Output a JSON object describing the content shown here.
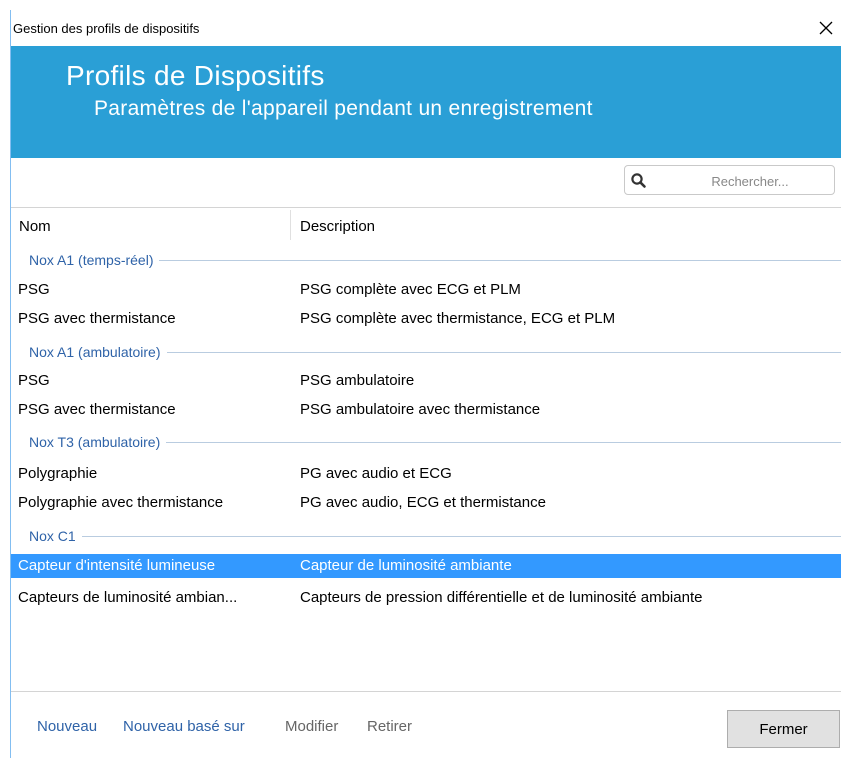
{
  "window": {
    "title": "Gestion des profils de dispositifs"
  },
  "banner": {
    "title": "Profils de Dispositifs",
    "subtitle": "Paramètres de l'appareil pendant un enregistrement",
    "color": "#2a9fd6"
  },
  "search": {
    "placeholder": "Rechercher..."
  },
  "table": {
    "columns": [
      "Nom",
      "Description"
    ],
    "groups": [
      {
        "label": "Nox A1 (temps-réel)",
        "rows": [
          {
            "name": "PSG",
            "description": "PSG complète avec ECG et PLM"
          },
          {
            "name": "PSG avec thermistance",
            "description": "PSG complète avec thermistance, ECG et PLM"
          }
        ]
      },
      {
        "label": "Nox A1 (ambulatoire)",
        "rows": [
          {
            "name": "PSG",
            "description": "PSG ambulatoire"
          },
          {
            "name": "PSG avec thermistance",
            "description": "PSG ambulatoire avec thermistance"
          }
        ]
      },
      {
        "label": "Nox T3 (ambulatoire)",
        "rows": [
          {
            "name": "Polygraphie",
            "description": "PG avec audio et ECG"
          },
          {
            "name": "Polygraphie avec thermistance",
            "description": "PG avec audio, ECG et thermistance"
          }
        ]
      },
      {
        "label": "Nox C1",
        "rows": [
          {
            "name": "Capteur d'intensité lumineuse",
            "description": "Capteur de luminosité ambiante",
            "selected": true
          },
          {
            "name": "Capteurs de luminosité ambian...",
            "description": "Capteurs de pression différentielle et de luminosité ambiante"
          }
        ]
      }
    ]
  },
  "actions": {
    "new": "Nouveau",
    "new_based_on": "Nouveau basé sur",
    "edit": "Modifier",
    "remove": "Retirer",
    "close": "Fermer"
  },
  "colors": {
    "selection": "#3399ff",
    "group_label": "#2f63a8"
  }
}
